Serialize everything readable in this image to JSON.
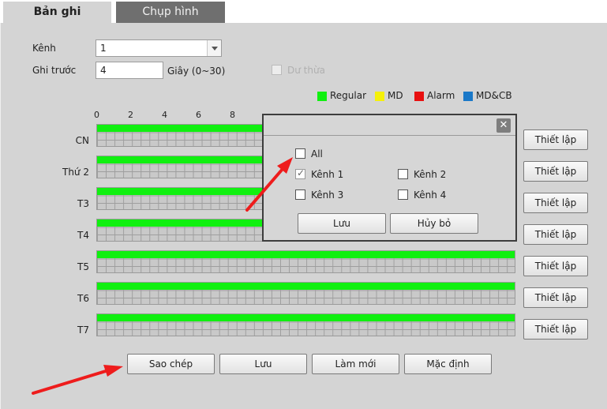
{
  "tabs": [
    {
      "label": "Bản ghi",
      "active": true
    },
    {
      "label": "Chụp hình",
      "active": false
    }
  ],
  "form": {
    "channel_label": "Kênh",
    "channel_value": "1",
    "prerecord_label": "Ghi trước",
    "prerecord_value": "4",
    "prerecord_unit": "Giây",
    "prerecord_range": "(0~30)",
    "redundant_label": "Dư thừa",
    "redundant_checked": false
  },
  "legend": [
    {
      "label": "Regular",
      "color": "#10f010"
    },
    {
      "label": "MD",
      "color": "#f5f00a"
    },
    {
      "label": "Alarm",
      "color": "#e81010"
    },
    {
      "label": "MD&CB",
      "color": "#1a78c8"
    }
  ],
  "hour_ticks": [
    "0",
    "2",
    "4",
    "6",
    "8"
  ],
  "days": [
    {
      "label": "CN",
      "setup": "Thiết lập"
    },
    {
      "label": "Thứ 2",
      "setup": "Thiết lập"
    },
    {
      "label": "T3",
      "setup": "Thiết lập"
    },
    {
      "label": "T4",
      "setup": "Thiết lập"
    },
    {
      "label": "T5",
      "setup": "Thiết lập"
    },
    {
      "label": "T6",
      "setup": "Thiết lập"
    },
    {
      "label": "T7",
      "setup": "Thiết lập"
    }
  ],
  "bottom_buttons": {
    "copy": "Sao chép",
    "save": "Lưu",
    "refresh": "Làm mới",
    "default": "Mặc định"
  },
  "dialog": {
    "close": "✕",
    "all_label": "All",
    "all_checked": false,
    "channels": [
      {
        "label": "Kênh 1",
        "checked": true
      },
      {
        "label": "Kênh 2",
        "checked": false
      },
      {
        "label": "Kênh 3",
        "checked": false
      },
      {
        "label": "Kênh 4",
        "checked": false
      }
    ],
    "save": "Lưu",
    "cancel": "Hủy bỏ"
  },
  "colors": {
    "annotation_arrow": "#ee1c1c",
    "regular_bar": "#10f010"
  }
}
